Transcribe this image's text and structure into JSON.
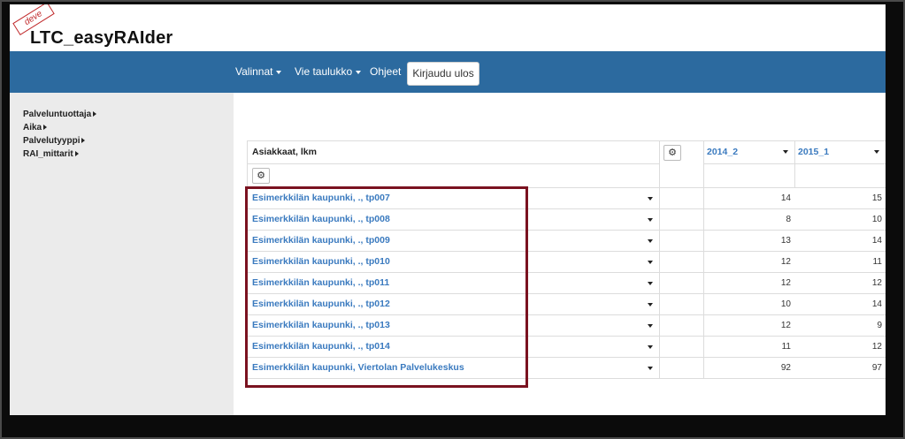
{
  "app": {
    "title": "LTC_easyRAIder",
    "badge": "deve"
  },
  "navbar": {
    "items": [
      "Valinnat",
      "Vie taulukko",
      "Ohjeet"
    ],
    "logout_label": "Kirjaudu ulos"
  },
  "sidebar": {
    "items": [
      "Palveluntuottaja",
      "Aika",
      "Palvelutyyppi",
      "RAI_mittarit"
    ]
  },
  "table": {
    "title": "Asiakkaat, lkm",
    "columns": [
      "2014_2",
      "2015_1"
    ],
    "rows": [
      {
        "label": "Esimerkkilän kaupunki, ., tp007",
        "values": [
          "14",
          "15"
        ]
      },
      {
        "label": "Esimerkkilän kaupunki, ., tp008",
        "values": [
          "8",
          "10"
        ]
      },
      {
        "label": "Esimerkkilän kaupunki, ., tp009",
        "values": [
          "13",
          "14"
        ]
      },
      {
        "label": "Esimerkkilän kaupunki, ., tp010",
        "values": [
          "12",
          "11"
        ]
      },
      {
        "label": "Esimerkkilän kaupunki, ., tp011",
        "values": [
          "12",
          "12"
        ]
      },
      {
        "label": "Esimerkkilän kaupunki, ., tp012",
        "values": [
          "10",
          "14"
        ]
      },
      {
        "label": "Esimerkkilän kaupunki, ., tp013",
        "values": [
          "12",
          "9"
        ]
      },
      {
        "label": "Esimerkkilän kaupunki, ., tp014",
        "values": [
          "11",
          "12"
        ]
      },
      {
        "label": "Esimerkkilän kaupunki, Viertolan Palvelukeskus",
        "values": [
          "92",
          "97"
        ]
      }
    ]
  },
  "colors": {
    "navbar": "#2c6a9f",
    "link": "#3a7abf",
    "highlight": "#7a1220"
  }
}
